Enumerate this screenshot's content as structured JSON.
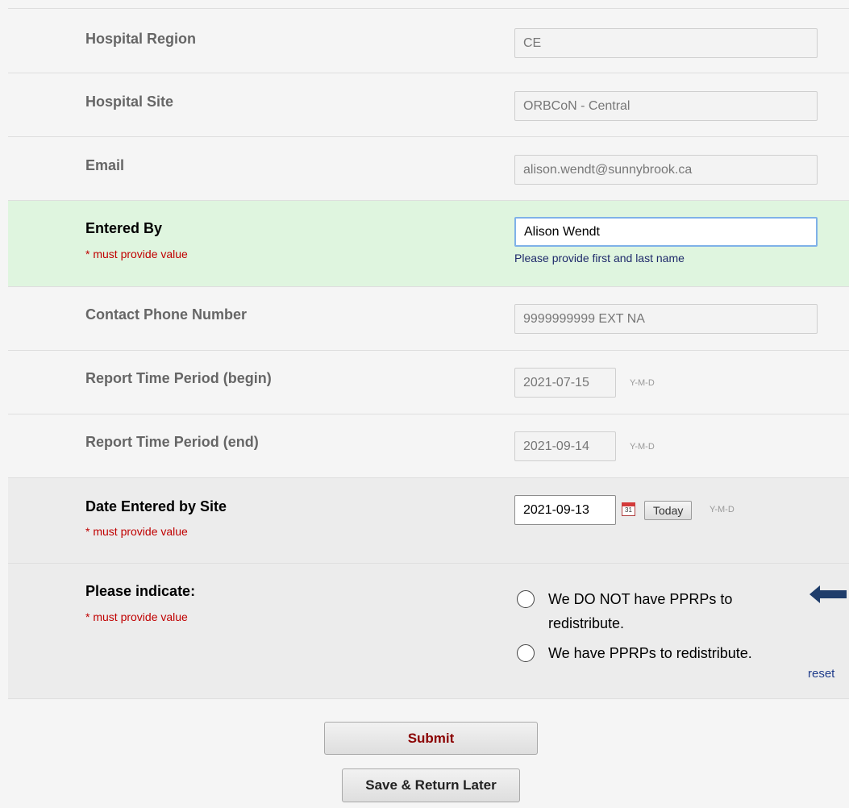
{
  "fields": {
    "region": {
      "label": "Hospital Region",
      "value": "CE"
    },
    "site": {
      "label": "Hospital Site",
      "value": "ORBCoN - Central"
    },
    "email": {
      "label": "Email",
      "value": "alison.wendt@sunnybrook.ca"
    },
    "entered_by": {
      "label": "Entered By",
      "required_note": "* must provide value",
      "value": "Alison Wendt",
      "hint": "Please provide first and last name"
    },
    "phone": {
      "label": "Contact Phone Number",
      "value": "9999999999 EXT NA"
    },
    "period_begin": {
      "label": "Report Time Period (begin)",
      "value": "2021-07-15",
      "format": "Y-M-D"
    },
    "period_end": {
      "label": "Report Time Period (end)",
      "value": "2021-09-14",
      "format": "Y-M-D"
    },
    "date_entered": {
      "label": "Date Entered by Site",
      "required_note": "* must provide value",
      "value": "2021-09-13",
      "calendar_day": "31",
      "today_label": "Today",
      "format": "Y-M-D"
    },
    "indicate": {
      "label": "Please indicate:",
      "required_note": "* must provide value",
      "options": [
        {
          "line1": "We DO NOT have PPRPs to",
          "line2": "redistribute."
        },
        {
          "line1": "We have PPRPs to redistribute."
        }
      ],
      "reset_label": "reset"
    }
  },
  "actions": {
    "submit_label": "Submit",
    "save_label": "Save & Return Later"
  },
  "colors": {
    "highlight_row": "#dff5df",
    "required_text": "#c00000",
    "submit_text": "#8b0000",
    "arrow": "#1f3d6b"
  }
}
